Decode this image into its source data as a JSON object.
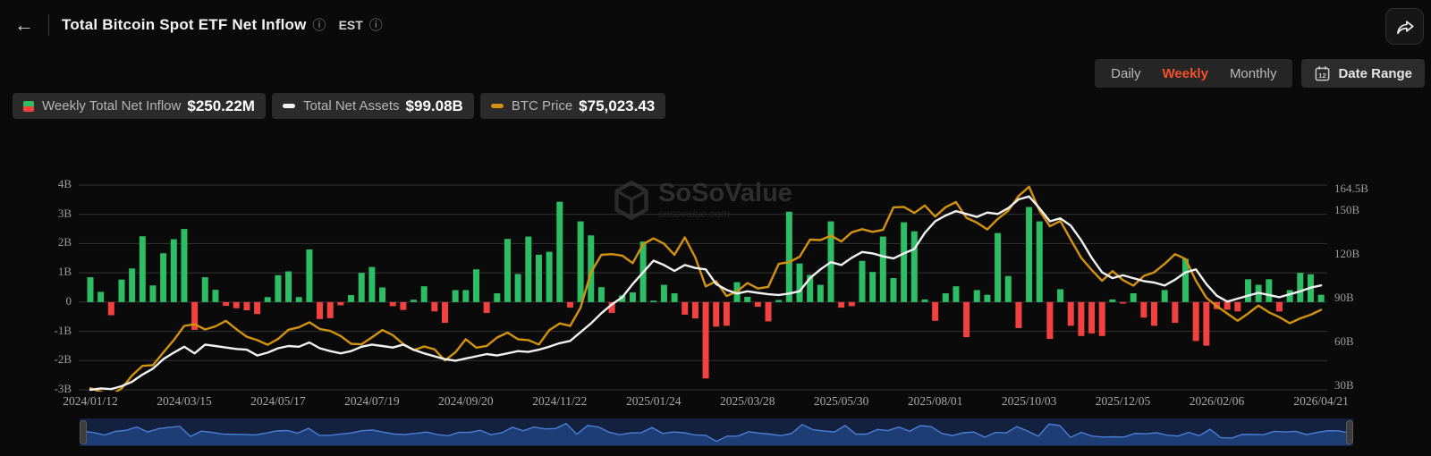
{
  "header": {
    "back_icon": "←",
    "title": "Total Bitcoin Spot ETF Net Inflow",
    "info_icon": "ⓘ",
    "timezone": "EST"
  },
  "toolbar": {
    "tabs": [
      "Daily",
      "Weekly",
      "Monthly"
    ],
    "active_tab": "Weekly",
    "date_range_label": "Date Range",
    "calendar_day": "12"
  },
  "legend": [
    {
      "label": "Weekly Total Net Inflow",
      "value": "$250.22M",
      "icon": "split-green-red-square"
    },
    {
      "label": "Total Net Assets",
      "value": "$99.08B",
      "icon": "white-dash"
    },
    {
      "label": "BTC Price",
      "value": "$75,023.43",
      "icon": "orange-dash"
    }
  ],
  "watermark": {
    "brand": "SoSoValue",
    "domain": "sosovalue.com"
  },
  "colors": {
    "background": "#0a0a0a",
    "accent": "#f4512c",
    "bar_positive": "#2dbd64",
    "bar_negative": "#f3413f",
    "assets_line": "#f2f2f2",
    "btc_line": "#d4930f",
    "grid": "#333333",
    "nav_bg": "#13203e",
    "nav_fill": "#1f3d75",
    "nav_line": "#4a7fd6",
    "nav_handle": "#3d3d3d"
  },
  "chart_data": {
    "type": "combo",
    "frequency": "weekly",
    "x_start": "2024/01/12",
    "x_end": "2026/04/21",
    "x_ticks": [
      {
        "i": 0,
        "label": "2024/01/12"
      },
      {
        "i": 9,
        "label": "2024/03/15"
      },
      {
        "i": 18,
        "label": "2024/05/17"
      },
      {
        "i": 27,
        "label": "2024/07/19"
      },
      {
        "i": 36,
        "label": "2024/09/20"
      },
      {
        "i": 45,
        "label": "2024/11/22"
      },
      {
        "i": 54,
        "label": "2025/01/24"
      },
      {
        "i": 63,
        "label": "2025/03/28"
      },
      {
        "i": 72,
        "label": "2025/05/30"
      },
      {
        "i": 81,
        "label": "2025/08/01"
      },
      {
        "i": 90,
        "label": "2025/10/03"
      },
      {
        "i": 99,
        "label": "2025/12/05"
      },
      {
        "i": 108,
        "label": "2026/02/06"
      },
      {
        "i": 118,
        "label": "2026/04/21"
      }
    ],
    "left_axis": {
      "unit": "B USD",
      "min": -3,
      "max": 4,
      "grid": true,
      "ticks": [
        {
          "label": "4B",
          "value": 4
        },
        {
          "label": "3B",
          "value": 3
        },
        {
          "label": "2B",
          "value": 2
        },
        {
          "label": "1B",
          "value": 1
        },
        {
          "label": "0",
          "value": 0
        },
        {
          "label": "-1B",
          "value": -1
        },
        {
          "label": "-2B",
          "value": -2
        },
        {
          "label": "-3B",
          "value": -3
        }
      ]
    },
    "right_axis": {
      "unit": "B USD",
      "min": 27.5,
      "max": 167.8,
      "ticks": [
        {
          "label": "164.5B",
          "value": 164.5
        },
        {
          "label": "150B",
          "value": 150
        },
        {
          "label": "120B",
          "value": 120
        },
        {
          "label": "90B",
          "value": 90
        },
        {
          "label": "60B",
          "value": 60
        },
        {
          "label": "30B",
          "value": 30
        }
      ]
    },
    "btc_axis": {
      "unit": "USD",
      "min": 42000,
      "max": 126500,
      "hidden": true
    },
    "series": [
      {
        "name": "Weekly Total Net Inflow",
        "type": "bar",
        "axis": "left",
        "unit": "B",
        "values": [
          0.85,
          0.35,
          -0.45,
          0.77,
          1.15,
          2.25,
          0.57,
          1.67,
          2.15,
          2.5,
          -0.95,
          0.85,
          0.42,
          -0.13,
          -0.21,
          -0.28,
          -0.41,
          0.17,
          0.92,
          1.05,
          0.17,
          1.8,
          -0.58,
          -0.55,
          -0.11,
          0.24,
          1.0,
          1.2,
          0.5,
          -0.14,
          -0.27,
          0.08,
          0.54,
          -0.32,
          -0.71,
          0.41,
          0.41,
          1.12,
          -0.37,
          0.3,
          2.16,
          0.96,
          2.24,
          1.62,
          1.72,
          3.43,
          -0.19,
          2.76,
          2.28,
          0.51,
          -0.37,
          0.23,
          0.33,
          2.07,
          0.05,
          0.59,
          0.3,
          -0.43,
          -0.56,
          -2.61,
          -0.84,
          -0.81,
          0.68,
          0.18,
          -0.16,
          -0.66,
          0.07,
          3.09,
          1.32,
          0.93,
          0.59,
          2.76,
          -0.19,
          -0.14,
          1.41,
          1.03,
          2.24,
          0.82,
          2.73,
          2.42,
          0.09,
          -0.64,
          0.3,
          0.54,
          -1.2,
          0.41,
          0.25,
          2.36,
          0.89,
          -0.89,
          3.25,
          2.76,
          -1.26,
          0.44,
          -0.81,
          -1.16,
          -1.07,
          -1.16,
          0.09,
          -0.05,
          0.3,
          -0.53,
          -0.81,
          0.41,
          -0.71,
          1.48,
          -1.33,
          -1.49,
          -0.24,
          -0.26,
          -0.32,
          0.78,
          0.59,
          0.78,
          -0.32,
          0.41,
          1.0,
          0.95,
          0.25
        ]
      },
      {
        "name": "Total Net Assets",
        "type": "line",
        "axis": "right",
        "unit": "B",
        "values": [
          27.5,
          28.5,
          28,
          30,
          33,
          38,
          42,
          48.5,
          53,
          57,
          52.5,
          58.5,
          57.5,
          56.5,
          55.5,
          55,
          51,
          53,
          56,
          57.5,
          57,
          60,
          56,
          54,
          52.5,
          54,
          57,
          58.5,
          57.5,
          56.5,
          58.5,
          55,
          52.5,
          50.5,
          48.5,
          47.5,
          49,
          50.5,
          52,
          51,
          52.5,
          54,
          53.5,
          55,
          57,
          59.5,
          61,
          67,
          73,
          80,
          86,
          91,
          100,
          108,
          116,
          113,
          109,
          113,
          111,
          110,
          100,
          96,
          93.5,
          95,
          94,
          93,
          92.5,
          93.5,
          95,
          104,
          110,
          115,
          113,
          118,
          122,
          121,
          119,
          117.5,
          121,
          124,
          135,
          143,
          147,
          150,
          148,
          146,
          149,
          148,
          152,
          158,
          160,
          152,
          143,
          145,
          140,
          130,
          118,
          108,
          104,
          106,
          104,
          102,
          101,
          99,
          103,
          108,
          110,
          100,
          92,
          88,
          90,
          92,
          94,
          92.5,
          91,
          93,
          95,
          97.5,
          99.08
        ]
      },
      {
        "name": "BTC Price",
        "type": "line",
        "axis": "btc",
        "unit": "USD",
        "values": [
          42700,
          41200,
          39900,
          42600,
          47900,
          51900,
          52200,
          57400,
          62500,
          68400,
          69100,
          66900,
          68200,
          70500,
          67000,
          63900,
          62500,
          60600,
          63000,
          66800,
          67800,
          69900,
          67100,
          66300,
          64200,
          61000,
          60800,
          63700,
          66700,
          64600,
          60900,
          58400,
          59900,
          58700,
          54100,
          57500,
          62900,
          59400,
          60100,
          63600,
          65600,
          62900,
          62500,
          60700,
          66600,
          69400,
          68400,
          75900,
          90500,
          97700,
          98000,
          97400,
          94300,
          102100,
          104500,
          102300,
          97700,
          104900,
          96600,
          84700,
          86800,
          80700,
          82600,
          86100,
          83800,
          84500,
          94000,
          94700,
          96900,
          104000,
          103800,
          105600,
          103200,
          107000,
          108300,
          107200,
          108000,
          117300,
          117500,
          115000,
          118100,
          113500,
          117400,
          119500,
          113000,
          111000,
          108200,
          112500,
          115900,
          122000,
          125800,
          116000,
          109500,
          111700,
          104000,
          96500,
          91500,
          87000,
          91000,
          87300,
          85000,
          89000,
          90500,
          94000,
          98000,
          96000,
          87000,
          80000,
          76500,
          73500,
          70500,
          73500,
          76800,
          74000,
          72000,
          69500,
          71500,
          73000,
          75023
        ]
      }
    ],
    "navigator": {
      "source_series": "Weekly Total Net Inflow"
    }
  }
}
